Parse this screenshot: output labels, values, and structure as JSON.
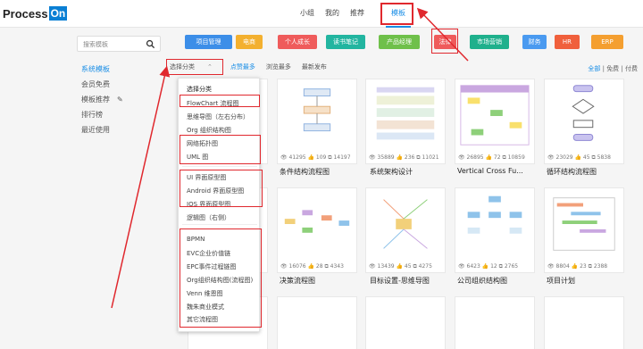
{
  "header": {
    "logo_text": "Process",
    "logo_on": "On",
    "nav": [
      "小组",
      "我的",
      "推荐",
      "模板"
    ]
  },
  "sidebar": {
    "search_placeholder": "搜索模板",
    "items": [
      "系统模板",
      "会员免费",
      "模板推荐",
      "排行榜",
      "最近使用"
    ]
  },
  "tags": [
    {
      "label": "项目管理",
      "color": "#3c8ee8"
    },
    {
      "label": "电商",
      "color": "#f3b02f"
    },
    {
      "label": "个人成长",
      "color": "#ef5b5b"
    },
    {
      "label": "读书笔记",
      "color": "#22b5a0"
    },
    {
      "label": "产品经理",
      "color": "#6fc04a"
    },
    {
      "label": "法律",
      "color": "#ef5b5b"
    },
    {
      "label": "市场营销",
      "color": "#1fb08c"
    },
    {
      "label": "财务",
      "color": "#4a9af0"
    },
    {
      "label": "HR",
      "color": "#f0603c"
    },
    {
      "label": "ERP",
      "color": "#f49f30"
    }
  ],
  "filter": {
    "category": "选择分类",
    "newest": "最新",
    "hot": "点赞最多",
    "views": "浏览最多",
    "published": "最新发布"
  },
  "right_filter": {
    "all": "全部",
    "free": "免费",
    "paid": "付费"
  },
  "dropdown": {
    "items": [
      "选择分类",
      "FlowChart 流程图",
      "思维导图（左右分布）",
      "Org 组织结构图",
      "网络拓扑图",
      "UML 图",
      "UI 界面原型图",
      "Android 界面原型图",
      "IOS 界面原型图",
      "逻辑图（右侧）",
      "BPMN",
      "EVC企业价值链",
      "EPC事件过程链图",
      "Org组织结构图(流程图)",
      "Venn 维恩图",
      "魏朱商业模式",
      "其它流程图"
    ]
  },
  "cards": [
    {
      "title": "条件结构流程图",
      "views": "41295",
      "likes": "109",
      "clones": "14197"
    },
    {
      "title": "系统架构设计",
      "views": "35889",
      "likes": "236",
      "clones": "11021"
    },
    {
      "title": "Vertical Cross Fu...",
      "views": "26895",
      "likes": "72",
      "clones": "10859"
    },
    {
      "title": "循环结构流程图",
      "views": "23029",
      "likes": "45",
      "clones": "5838"
    },
    {
      "title": "决策流程图",
      "views": "16076",
      "likes": "28",
      "clones": "4343"
    },
    {
      "title": "目标设置-思维导图",
      "views": "13439",
      "likes": "45",
      "clones": "4275"
    },
    {
      "title": "公司组织结构图",
      "views": "6423",
      "likes": "12",
      "clones": "2765"
    },
    {
      "title": "项目计划",
      "views": "8804",
      "likes": "23",
      "clones": "2388"
    }
  ]
}
